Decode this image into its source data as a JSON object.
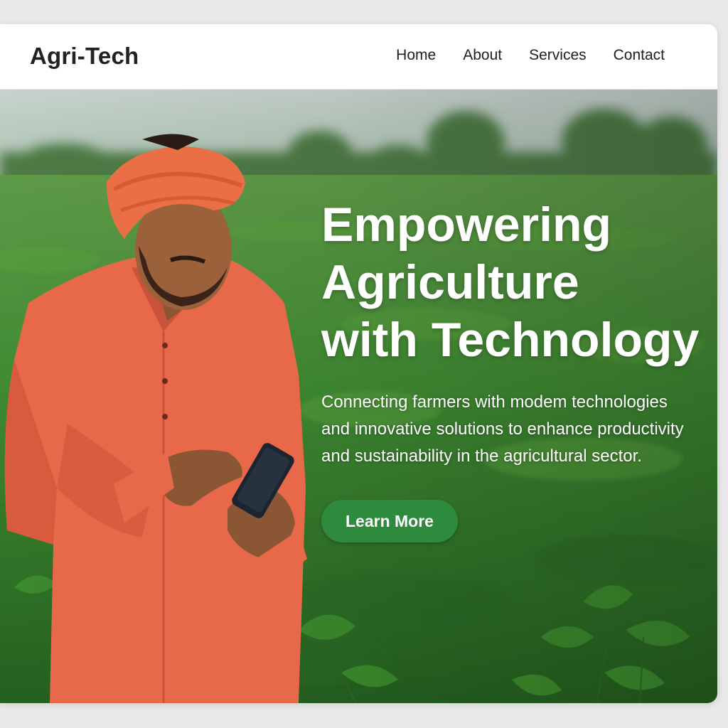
{
  "brand": {
    "name": "Agri-Tech"
  },
  "nav": {
    "items": [
      {
        "label": "Home"
      },
      {
        "label": "About"
      },
      {
        "label": "Services"
      },
      {
        "label": "Contact"
      }
    ]
  },
  "hero": {
    "title_lines": [
      "Empowering",
      "Agriculture",
      "with Technology"
    ],
    "subtitle": "Connecting farmers with modem technologies and innovative solutions to enhance productivity and sustainability in the agricultural sector.",
    "cta_label": "Learn More",
    "image": {
      "subject": "farmer-using-smartphone-in-crop-field",
      "colors": {
        "sky": "#c9d6cf",
        "field": "#3f8a32",
        "shirt": "#e8694a",
        "turban": "#ea6f45"
      }
    }
  },
  "colors": {
    "accent": "#2e8a3c",
    "brand_text": "#222222"
  }
}
